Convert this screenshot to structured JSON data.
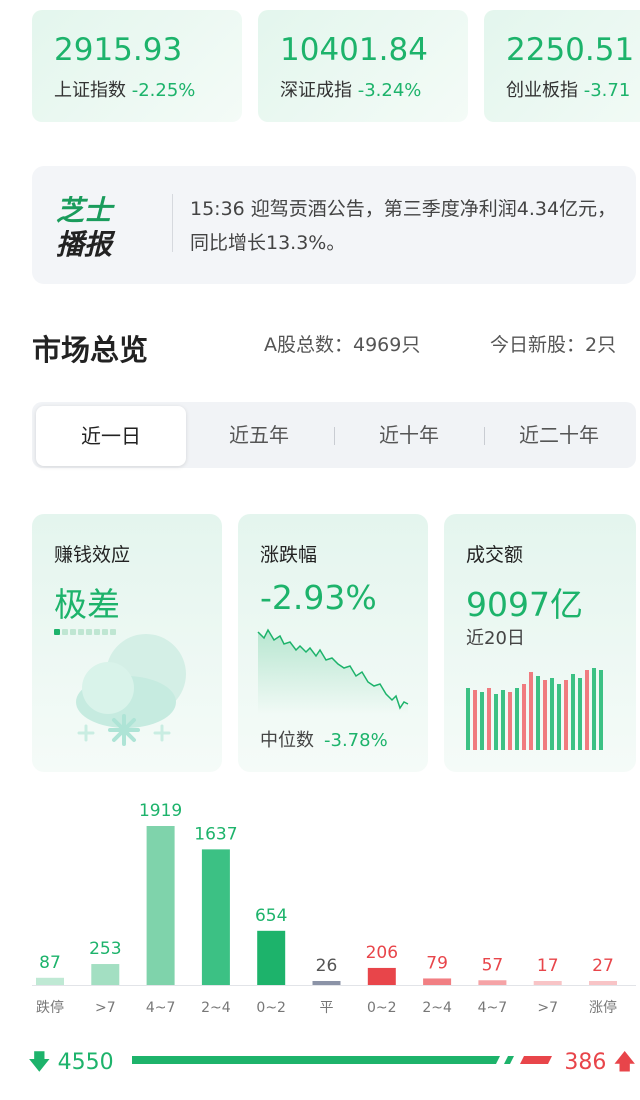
{
  "indices": [
    {
      "value": "2915.93",
      "name": "上证指数",
      "change": "-2.25%"
    },
    {
      "value": "10401.84",
      "name": "深证成指",
      "change": "-3.24%"
    },
    {
      "value": "2250.51",
      "name": "创业板指",
      "change": "-3.71"
    }
  ],
  "news": {
    "logo_line1": "芝士",
    "logo_line2": "播报",
    "text": "15:36 迎驾贡酒公告，第三季度净利润4.34亿元，同比增长13.3%。"
  },
  "market": {
    "title": "市场总览",
    "total_stocks": "A股总数：4969只",
    "new_stocks": "今日新股：2只"
  },
  "tabs": [
    "近一日",
    "近五年",
    "近十年",
    "近二十年"
  ],
  "cards": {
    "profit_effect": {
      "label": "赚钱效应",
      "value": "极差"
    },
    "change": {
      "label": "涨跌幅",
      "value": "-2.93%",
      "median_label": "中位数",
      "median_value": "-3.78%"
    },
    "turnover": {
      "label": "成交额",
      "value": "9097亿",
      "sub": "近20日"
    }
  },
  "colors": {
    "green": "#1db36b",
    "red": "#e8454a",
    "gray": "#7a7f8a"
  },
  "chart_data": {
    "type": "bar",
    "categories": [
      "跌停",
      ">7",
      "4~7",
      "2~4",
      "0~2",
      "平",
      "0~2",
      "2~4",
      "4~7",
      ">7",
      "涨停"
    ],
    "values": [
      87,
      253,
      1919,
      1637,
      654,
      26,
      206,
      79,
      57,
      17,
      27
    ],
    "ylim": [
      0,
      1919
    ],
    "grid": false
  },
  "summary": {
    "down": "4550",
    "up": "386"
  }
}
